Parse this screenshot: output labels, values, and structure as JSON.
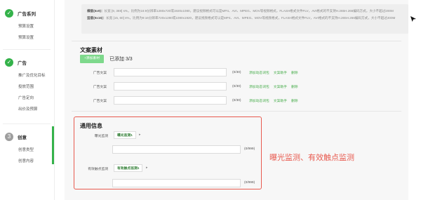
{
  "sidebar": {
    "groups": [
      {
        "title": "广告系列",
        "status": "done",
        "items": [
          "预算设置",
          "预算设置"
        ]
      },
      {
        "title": "广告",
        "status": "done",
        "items": [
          "推广及优化目标",
          "投放范围",
          "广告定向",
          "出价及预算"
        ]
      },
      {
        "title": "创意",
        "status": "current",
        "number": "3",
        "items": [
          "创意类型",
          "创意内容"
        ]
      }
    ],
    "check_glyph": "✓"
  },
  "hints": {
    "line1_label": "横版(6x9)：",
    "line1_text": "长宽 [9, 369] s%，比例为16:9分辨率1280x720或1920x1080，建议视频格式可以是MP4、AVI、MPEG、MOV等视频格式，FLASH格式文件FLV，AVI格式的不支持H.265H.266编码方式，大小不超过200M",
    "line2_label": "竖版(9x16)：",
    "line2_text": "长宽 [15, 60] s%，比例为9:16分辨率720x1280或1080x1920，建议视频格式可以是MP4、AVI、MPEG、MOV等视频格式，FLASH格式文件FLV，AVI格式的不支持H.265H.266编码方式，大小不超过200M"
  },
  "copy_section": {
    "title": "文案素材",
    "add_button": "+添加素材",
    "added_text": "已添加 3/3",
    "rows": [
      {
        "label": "广告文案",
        "count": "(0/30)",
        "links": [
          "添加动态词包",
          "文案助手",
          "删除"
        ]
      },
      {
        "label": "广告文案",
        "count": "(0/30)",
        "links": [
          "添加动态词包",
          "文案助手",
          "删除"
        ]
      },
      {
        "label": "广告文案",
        "count": "(0/30)",
        "links": [
          "添加动态词包",
          "文案助手",
          "删除"
        ]
      }
    ]
  },
  "general_section": {
    "title": "通用信息",
    "exposure": {
      "label": "曝光监测",
      "tag": "曝光监测1",
      "count": "(0/999)"
    },
    "click": {
      "label": "有效触点监测",
      "tag": "有效触点监测1",
      "count": "(0/999)"
    }
  },
  "annotation": "曝光监测、有效触点监测",
  "colors": {
    "brand_green": "#34b24a",
    "highlight_red": "#e85a4f"
  },
  "icons": {
    "tag_toggle": "▸"
  }
}
